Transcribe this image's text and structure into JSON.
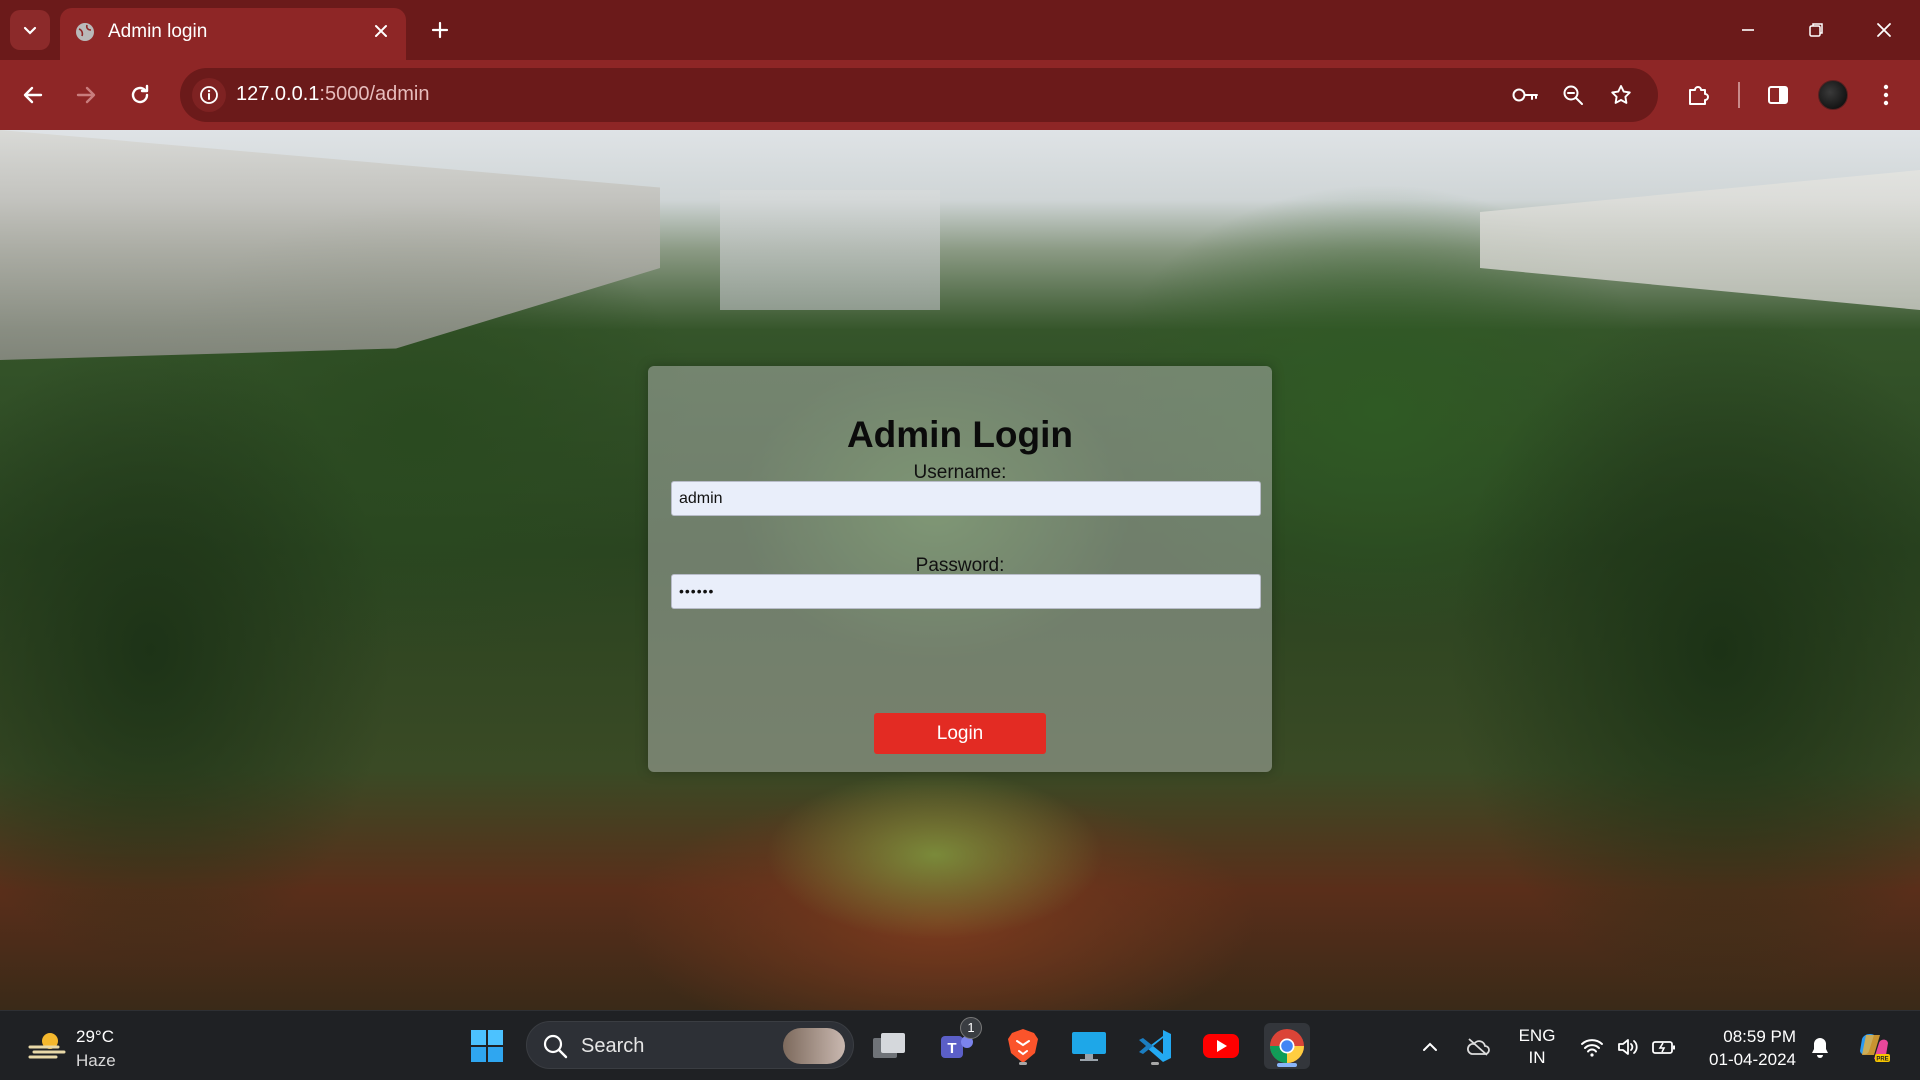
{
  "browser": {
    "tab_title": "Admin login",
    "url_host": "127.0.0.1",
    "url_path": ":5000/admin"
  },
  "page": {
    "heading": "Admin Login",
    "username_label": "Username:",
    "username_value": "admin",
    "password_label": "Password:",
    "password_value": "••••••",
    "login_button": "Login"
  },
  "taskbar": {
    "weather_temp": "29°C",
    "weather_condition": "Haze",
    "search_placeholder": "Search",
    "teams_badge": "1",
    "lang_top": "ENG",
    "lang_bottom": "IN",
    "time": "08:59 PM",
    "date": "01-04-2024"
  },
  "colors": {
    "chrome_frame": "#6b1a1a",
    "chrome_toolbar": "#8e2626",
    "login_button": "#e32b23"
  }
}
